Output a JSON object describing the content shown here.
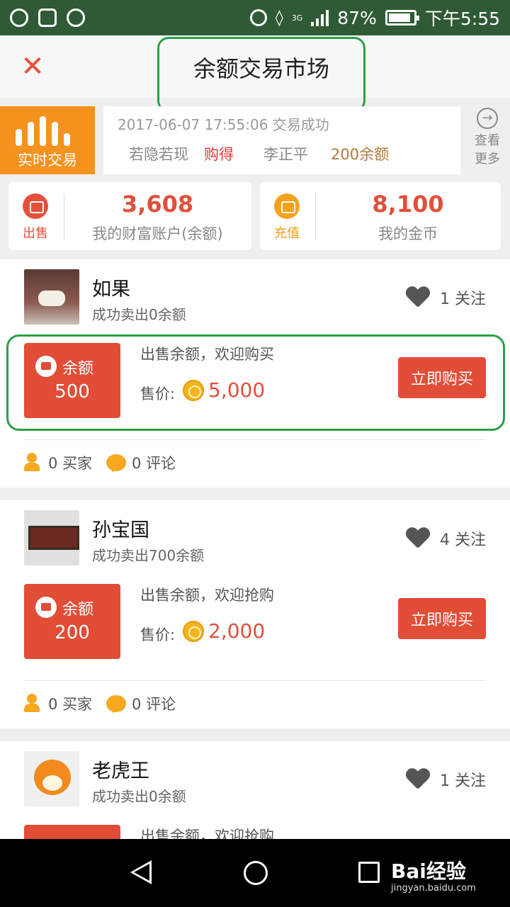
{
  "status_bar": {
    "network": "3G",
    "battery": "87%",
    "time": "下午5:55"
  },
  "header": {
    "title": "余额交易市场"
  },
  "ticker": {
    "badge": "实时交易",
    "time": "2017-06-07 17:55:06 交易成功",
    "user": "若隐若现",
    "action": "购得",
    "seller": "李正平",
    "amount": "200余额",
    "more": "查看\n更多"
  },
  "stats": [
    {
      "tag": "出售",
      "value": "3,608",
      "label": "我的财富账户(余额)"
    },
    {
      "tag": "充值",
      "value": "8,100",
      "label": "我的金币"
    }
  ],
  "listings": [
    {
      "name": "如果",
      "sold": "成功卖出0余额",
      "follow": "1 关注",
      "balance_label": "余额",
      "balance": "500",
      "desc": "出售余额，欢迎购买",
      "price_label": "售价:",
      "price": "5,000",
      "buy": "立即购买",
      "buyers": "0 买家",
      "comments": "0 评论"
    },
    {
      "name": "孙宝国",
      "sold": "成功卖出700余额",
      "follow": "4 关注",
      "balance_label": "余额",
      "balance": "200",
      "desc": "出售余额，欢迎抢购",
      "price_label": "售价:",
      "price": "2,000",
      "buy": "立即购买",
      "buyers": "0 买家",
      "comments": "0 评论"
    },
    {
      "name": "老虎王",
      "sold": "成功卖出0余额",
      "follow": "1 关注",
      "desc": "出售余额，欢迎抢购"
    }
  ],
  "watermark": {
    "brand": "Bai经验",
    "url": "jingyan.baidu.com"
  }
}
